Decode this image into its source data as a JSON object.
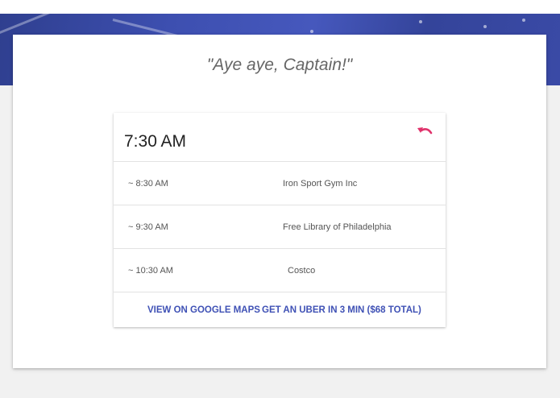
{
  "hero": {
    "quote": "\"Aye aye, Captain!\""
  },
  "itinerary": {
    "start_time": "7:30 AM",
    "undo_icon": "undo-icon",
    "accent_color": "#e0326b",
    "stops": [
      {
        "time": "~ 8:30 AM",
        "place": "Iron Sport Gym Inc"
      },
      {
        "time": "~ 9:30 AM",
        "place": "Free Library of Philadelphia"
      },
      {
        "time": "~ 10:30 AM",
        "place": "Costco"
      }
    ],
    "actions": {
      "maps_label": "VIEW ON GOOGLE MAPS",
      "uber_label": "GET AN UBER IN 3 MIN ($68 TOTAL)"
    }
  },
  "colors": {
    "link": "#3f51b5",
    "hero": "#3d4fb0"
  }
}
